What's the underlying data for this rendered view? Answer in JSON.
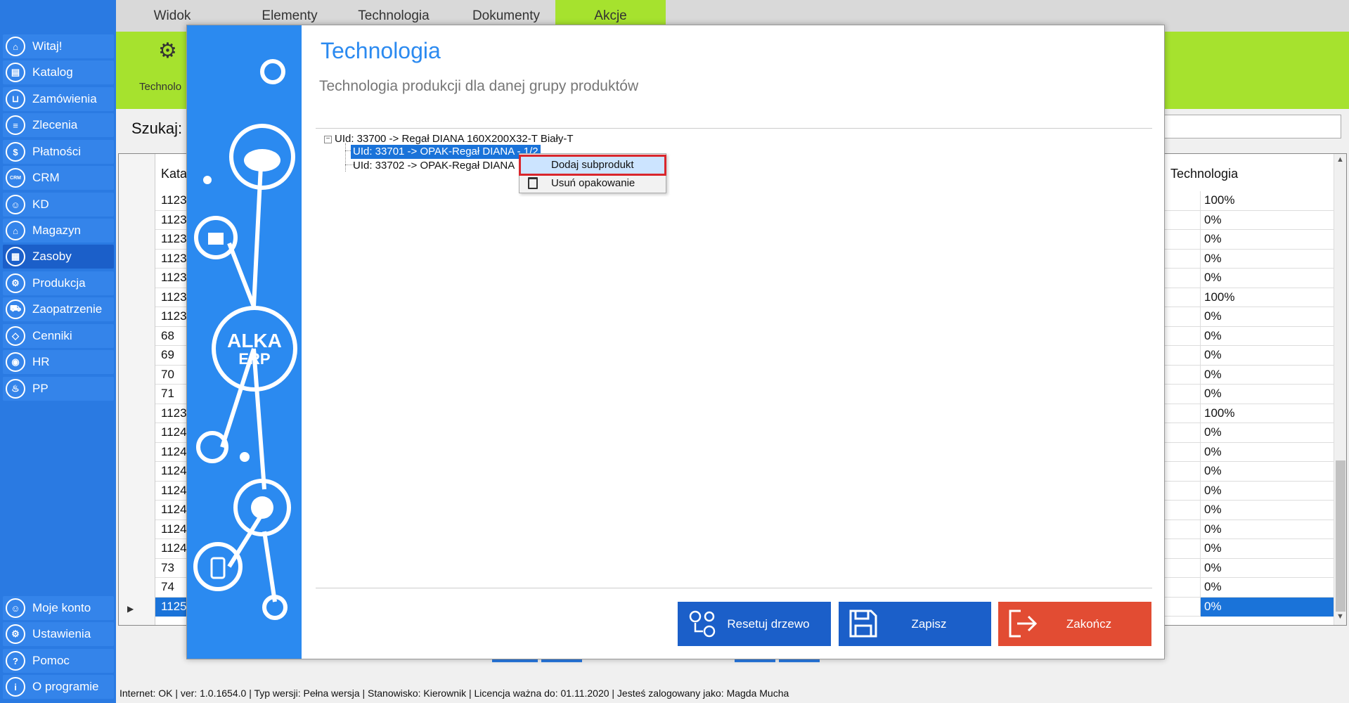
{
  "top_menu": {
    "tabs": [
      "Widok",
      "Elementy",
      "Technologia",
      "Dokumenty",
      "Akcje"
    ]
  },
  "ribbon": {
    "label": "Technolo"
  },
  "sidebar": {
    "items": [
      {
        "label": "Witaj!",
        "icon": "home-icon"
      },
      {
        "label": "Katalog",
        "icon": "book-icon"
      },
      {
        "label": "Zamówienia",
        "icon": "cart-icon"
      },
      {
        "label": "Zlecenia",
        "icon": "list-icon"
      },
      {
        "label": "Płatności",
        "icon": "dollar-icon"
      },
      {
        "label": "CRM",
        "icon": "crm-icon"
      },
      {
        "label": "KD",
        "icon": "person-icon"
      },
      {
        "label": "Magazyn",
        "icon": "warehouse-icon"
      },
      {
        "label": "Zasoby",
        "icon": "resources-icon",
        "active": true
      },
      {
        "label": "Produkcja",
        "icon": "production-icon"
      },
      {
        "label": "Zaopatrzenie",
        "icon": "truck-icon"
      },
      {
        "label": "Cenniki",
        "icon": "tag-icon"
      },
      {
        "label": "HR",
        "icon": "hr-icon"
      },
      {
        "label": "PP",
        "icon": "pp-icon"
      }
    ],
    "bottom_items": [
      {
        "label": "Moje konto",
        "icon": "account-icon"
      },
      {
        "label": "Ustawienia",
        "icon": "settings-icon"
      },
      {
        "label": "Pomoc",
        "icon": "help-icon"
      },
      {
        "label": "O programie",
        "icon": "info-icon"
      }
    ]
  },
  "search": {
    "label": "Szukaj:"
  },
  "grid": {
    "col_katalog": "Kata",
    "col_technologia": "Technologia",
    "rows": [
      {
        "kat": "1123",
        "tech": "100%"
      },
      {
        "kat": "1123",
        "tech": "0%"
      },
      {
        "kat": "1123",
        "tech": "0%"
      },
      {
        "kat": "1123",
        "tech": "0%"
      },
      {
        "kat": "1123",
        "tech": "0%"
      },
      {
        "kat": "1123",
        "tech": "100%"
      },
      {
        "kat": "1123",
        "tech": "0%"
      },
      {
        "kat": "68",
        "tech": "0%"
      },
      {
        "kat": "69",
        "tech": "0%"
      },
      {
        "kat": "70",
        "tech": "0%"
      },
      {
        "kat": "71",
        "tech": "0%"
      },
      {
        "kat": "1123",
        "tech": "100%"
      },
      {
        "kat": "1124",
        "tech": "0%"
      },
      {
        "kat": "1124",
        "tech": "0%"
      },
      {
        "kat": "1124",
        "tech": "0%"
      },
      {
        "kat": "1124",
        "tech": "0%"
      },
      {
        "kat": "1124",
        "tech": "0%"
      },
      {
        "kat": "1124",
        "tech": "0%"
      },
      {
        "kat": "1124",
        "tech": "0%"
      },
      {
        "kat": "73",
        "tech": "0%"
      },
      {
        "kat": "74",
        "tech": "0%"
      },
      {
        "kat": "1125",
        "tech": "0%",
        "selected": true
      }
    ]
  },
  "dialog": {
    "title": "Technologia",
    "subtitle": "Technologia produkcji dla danej grupy produktów",
    "tree": {
      "root": "UId: 33700 -> Regał DIANA 160X200X32-T Biały-T",
      "children": [
        {
          "label": "UId: 33701 -> OPAK-Regał DIANA - 1/2",
          "selected": true
        },
        {
          "label": "UId: 33702 -> OPAK-Regał DIANA"
        }
      ]
    },
    "context_menu": {
      "items": [
        {
          "label": "Dodaj subprodukt",
          "highlighted": true
        },
        {
          "label": "Usuń opakowanie",
          "icon": "trash-icon"
        }
      ]
    },
    "buttons": {
      "reset": "Resetuj drzewo",
      "save": "Zapisz",
      "close": "Zakończ"
    },
    "logo": {
      "line1": "ALKA",
      "line2": "ERP"
    }
  },
  "statusbar": {
    "text": "Internet: OK  |  ver: 1.0.1654.0  |  Typ wersji: Pełna wersja  |  Stanowisko: Kierownik  |  Licencja ważna do: 01.11.2020  |  Jesteś zalogowany jako: Magda Mucha"
  },
  "colors": {
    "sidebar": "#2a7ae2",
    "ribbon": "#a6e22e",
    "dialog_accent": "#2b8af0",
    "selection": "#1a73d9",
    "close_button": "#e24c33",
    "highlight_border": "#d9262c"
  }
}
